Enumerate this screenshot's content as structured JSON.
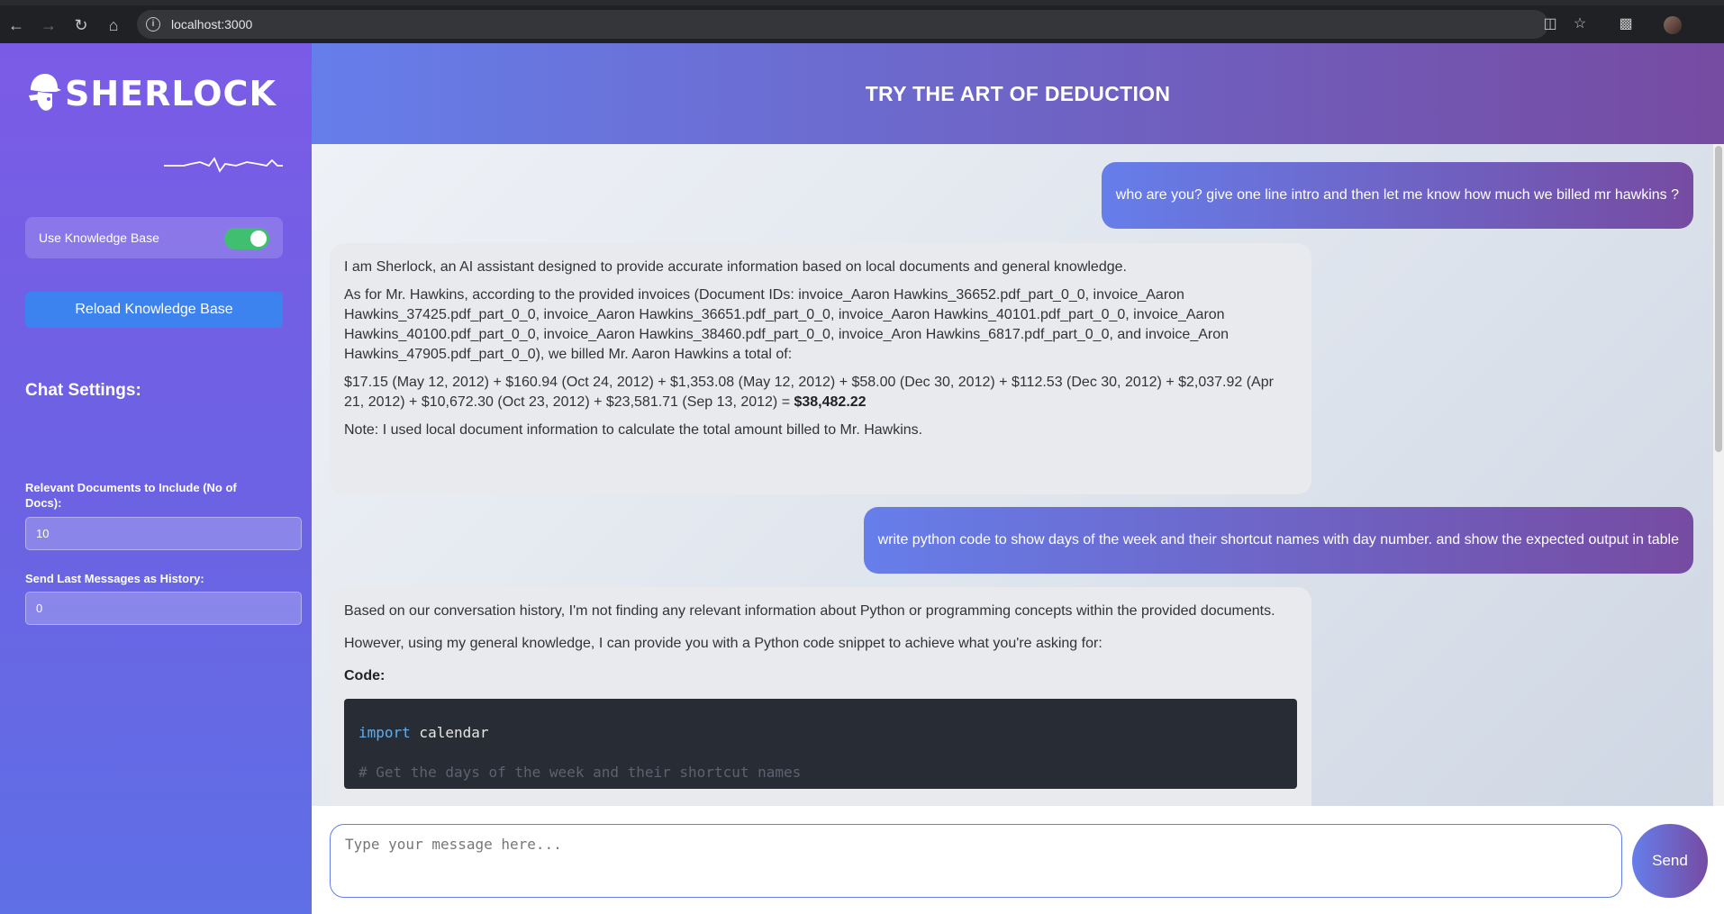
{
  "browser": {
    "url": "localhost:3000",
    "icons": [
      "back-icon",
      "forward-icon",
      "reload-icon",
      "home-icon",
      "site-info-icon",
      "install-icon",
      "bookmark-star-icon",
      "extensions-icon",
      "profile-avatar"
    ]
  },
  "sidebar": {
    "brand": "SHERLOCK",
    "knowledge_base_label": "Use Knowledge Base",
    "knowledge_base_enabled": true,
    "reload_label": "Reload Knowledge Base",
    "settings_heading": "Chat Settings:",
    "docs_label": "Relevant Documents to Include (No of Docs):",
    "docs_value": "10",
    "history_label": "Send Last Messages as History:",
    "history_value": "0"
  },
  "header": {
    "title": "TRY THE ART OF DEDUCTION"
  },
  "colors": {
    "accent_start": "#667eea",
    "accent_end": "#764ba2",
    "toggle_on": "#3fbf6f",
    "reload_button": "#3d83f0"
  },
  "messages": [
    {
      "role": "user",
      "text": "who are you? give one line intro and then let me know how much we billed mr hawkins ?"
    },
    {
      "role": "assistant",
      "p1": "I am Sherlock, an AI assistant designed to provide accurate information based on local documents and general knowledge.",
      "p2": "As for Mr. Hawkins, according to the provided invoices (Document IDs: invoice_Aaron Hawkins_36652.pdf_part_0_0, invoice_Aaron Hawkins_37425.pdf_part_0_0, invoice_Aaron Hawkins_36651.pdf_part_0_0, invoice_Aaron Hawkins_40101.pdf_part_0_0, invoice_Aaron Hawkins_40100.pdf_part_0_0, invoice_Aaron Hawkins_38460.pdf_part_0_0, invoice_Aron Hawkins_6817.pdf_part_0_0, and invoice_Aron Hawkins_47905.pdf_part_0_0), we billed Mr. Aaron Hawkins a total of:",
      "p3": "$17.15 (May 12, 2012) + $160.94 (Oct 24, 2012) + $1,353.08 (May 12, 2012) + $58.00 (Dec 30, 2012) + $112.53 (Dec 30, 2012) + $2,037.92 (Apr 21, 2012) + $10,672.30 (Oct 23, 2012) + $23,581.71 (Sep 13, 2012) = ",
      "total": "$38,482.22",
      "p4": "Note: I used local document information to calculate the total amount billed to Mr. Hawkins."
    },
    {
      "role": "user",
      "text": "write python code to show days of the week and their shortcut names with day number. and show the expected output in table"
    },
    {
      "role": "assistant",
      "p1": "Based on our conversation history, I'm not finding any relevant information about Python or programming concepts within the provided documents.",
      "p2": "However, using my general knowledge, I can provide you with a Python code snippet to achieve what you're asking for:",
      "code_heading": "Code:",
      "code_kw": "import",
      "code_rest": " calendar",
      "code_comment": "# Get the days of the week and their shortcut names"
    }
  ],
  "composer": {
    "placeholder": "Type your message here...",
    "send_label": "Send"
  }
}
